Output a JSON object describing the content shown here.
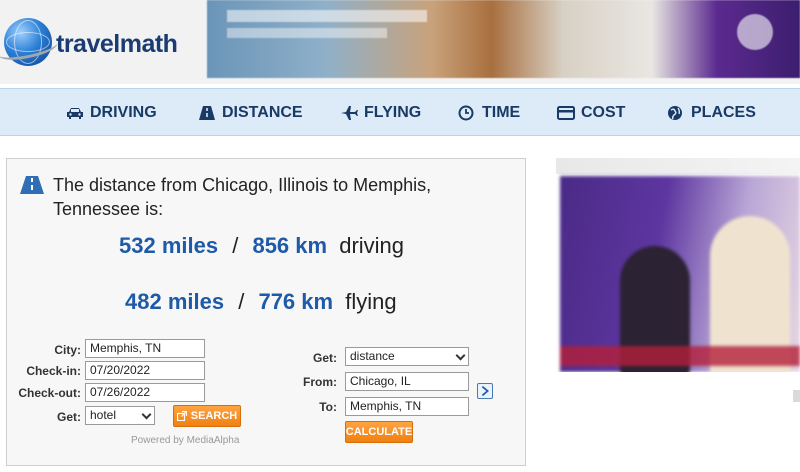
{
  "logo": {
    "text_travel": "travel",
    "text_math": "math"
  },
  "nav": {
    "items": [
      {
        "label": "DRIVING",
        "icon": "car-icon"
      },
      {
        "label": "DISTANCE",
        "icon": "road-icon"
      },
      {
        "label": "FLYING",
        "icon": "plane-icon"
      },
      {
        "label": "TIME",
        "icon": "clock-icon"
      },
      {
        "label": "COST",
        "icon": "credit-card-icon"
      },
      {
        "label": "PLACES",
        "icon": "globe-icon"
      }
    ]
  },
  "result": {
    "headline": "The distance from Chicago, Illinois to Memphis, Tennessee is:",
    "driving_miles": "532 miles",
    "driving_km": "856 km",
    "driving_label": "driving",
    "flying_miles": "482 miles",
    "flying_km": "776 km",
    "flying_label": "flying",
    "separator": "/"
  },
  "hotel_form": {
    "city_label": "City:",
    "city_value": "Memphis, TN",
    "checkin_label": "Check-in:",
    "checkin_value": "07/20/2022",
    "checkout_label": "Check-out:",
    "checkout_value": "07/26/2022",
    "get_label": "Get:",
    "get_value": "hotel",
    "search_button": "SEARCH",
    "powered_by": "Powered by MediaAlpha"
  },
  "calc_form": {
    "get_label": "Get:",
    "get_value": "distance",
    "from_label": "From:",
    "from_value": "Chicago, IL",
    "to_label": "To:",
    "to_value": "Memphis, TN",
    "calculate_button": "CALCULATE"
  },
  "colors": {
    "accent_blue": "#1e5aa8",
    "nav_bg": "#dcebf7",
    "button_orange": "#f08a1c"
  }
}
